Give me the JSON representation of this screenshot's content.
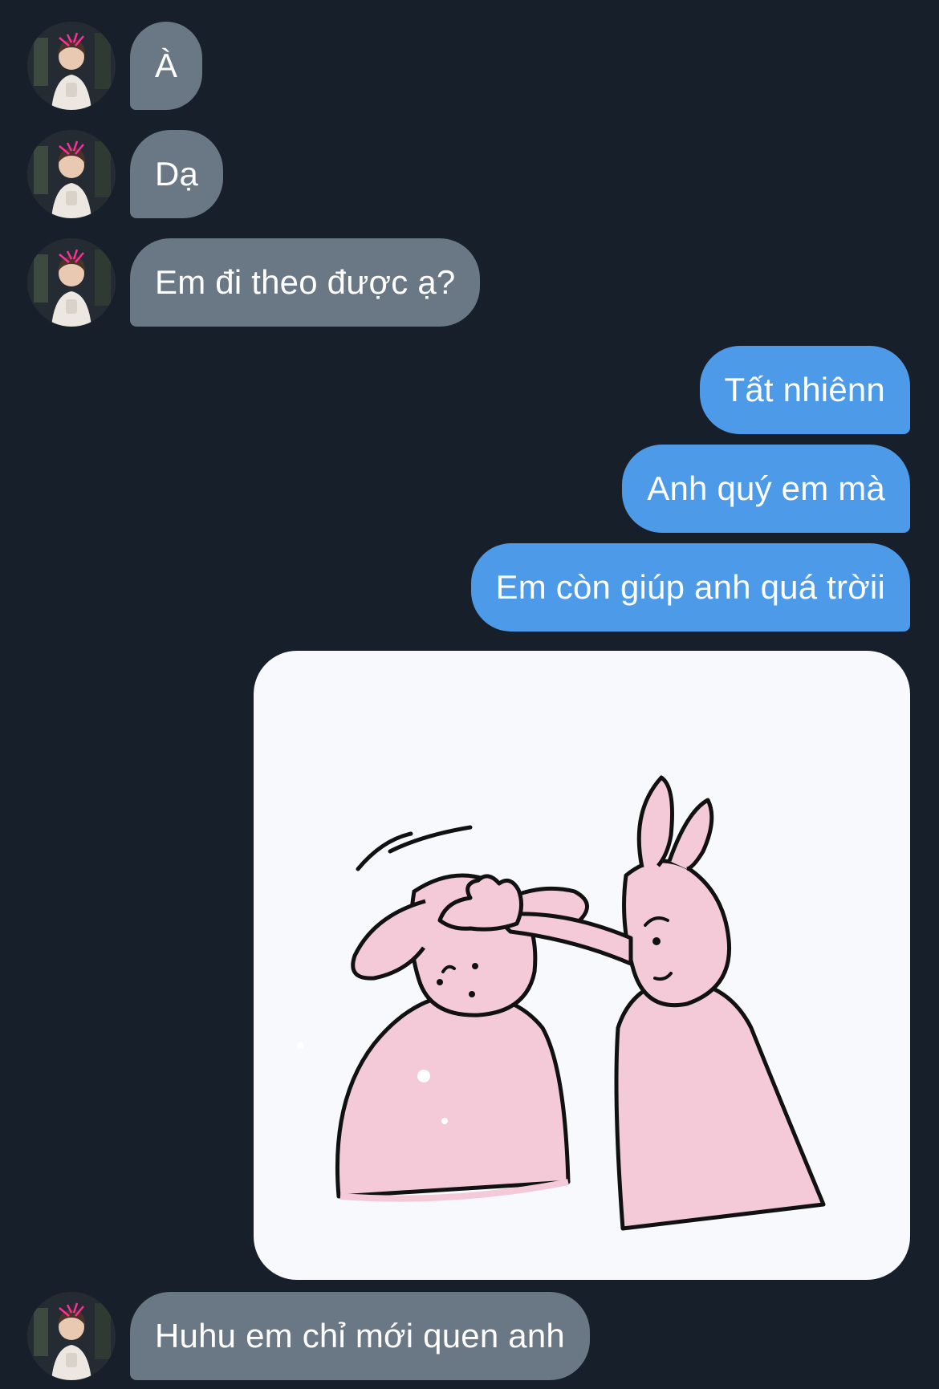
{
  "colors": {
    "background": "#171f2a",
    "incoming_bubble": "#6a7785",
    "outgoing_bubble": "#4d9be8",
    "sticker_background": "#f7f9fd",
    "sticker_character": "#f4c9d8"
  },
  "messages": [
    {
      "direction": "incoming",
      "text": "À",
      "avatar_icon": "user-avatar"
    },
    {
      "direction": "incoming",
      "text": "Dạ",
      "avatar_icon": "user-avatar"
    },
    {
      "direction": "incoming",
      "text": "Em đi theo được ạ?",
      "avatar_icon": "user-avatar"
    },
    {
      "direction": "outgoing",
      "text": "Tất nhiênn"
    },
    {
      "direction": "outgoing",
      "text": "Anh quý em mà"
    },
    {
      "direction": "outgoing",
      "text": "Em còn giúp anh quá trờii"
    },
    {
      "direction": "outgoing",
      "type": "sticker",
      "sticker_icon": "pink-bunny-head-pat-sticker"
    },
    {
      "direction": "incoming",
      "text": "Huhu em chỉ mới quen anh",
      "avatar_icon": "user-avatar"
    }
  ]
}
